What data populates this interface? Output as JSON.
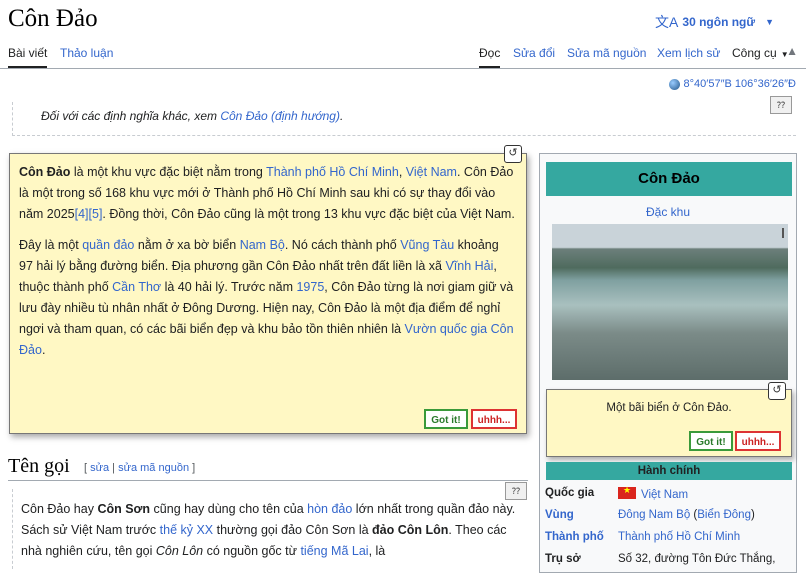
{
  "page": {
    "title": "Côn Đảo"
  },
  "language_button": {
    "label": "30 ngôn ngữ"
  },
  "tabs": {
    "article": "Bài viết",
    "talk": "Thảo luận",
    "read": "Đọc",
    "edit": "Sửa đổi",
    "edit_source": "Sửa mã nguồn",
    "history": "Xem lịch sử",
    "tools": "Công cụ"
  },
  "coordinates": "8°40′57″B 106°36′26″Đ",
  "hatnote": {
    "text": "Đối với các định nghĩa khác, xem ",
    "link": "Côn Đảo (định hướng)",
    "end": "."
  },
  "lead": {
    "p1_bold": "Côn Đảo",
    "p1_a": " là một khu vực đặc biệt nằm trong ",
    "p1_link1": "Thành phố Hồ Chí Minh",
    "p1_comma": ", ",
    "p1_link2": "Việt Nam",
    "p1_b": ". Côn Đảo là một trong số 168 khu vực mới ở Thành phố Hồ Chí Minh sau khi có sự thay đổi vào năm 2025",
    "ref4": "[4]",
    "ref5": "[5]",
    "p1_c": ". Đồng thời, Côn Đảo cũng là một trong 13 khu vực đặc biệt của Việt Nam.",
    "p2_a": "Đây là một ",
    "p2_link1": "quần đảo",
    "p2_b": " nằm ở xa bờ biển ",
    "p2_link2": "Nam Bộ",
    "p2_c": ". Nó cách thành phố ",
    "p2_link3": "Vũng Tàu",
    "p2_d": " khoảng 97 hải lý bằng đường biển. Địa phương gần Côn Đảo nhất trên đất liền là xã ",
    "p2_link4": "Vĩnh Hải",
    "p2_e": ", thuộc thành phố ",
    "p2_link5": "Cần Thơ",
    "p2_f": " là 40 hải lý. Trước năm ",
    "p2_link6": "1975",
    "p2_g": ", Côn Đảo từng là nơi giam giữ và lưu đày nhiều tù nhân nhất ở Đông Dương. Hiện nay, Côn Đảo là một địa điểm để nghỉ ngơi và tham quan, có các bãi biển đẹp và khu bảo tồn thiên nhiên là ",
    "p2_link7": "Vườn quốc gia Côn Đảo",
    "p2_h": "."
  },
  "buttons": {
    "got_it": "Got it!",
    "uhhh": "uhhh..."
  },
  "section": {
    "heading": "Tên gọi",
    "edit_open": "[ ",
    "edit": "sửa",
    "sep": " | ",
    "edit_source": "sửa mã nguồn",
    "edit_close": " ]",
    "t1": "Côn Đảo hay ",
    "b1": "Côn Sơn",
    "t2": " cũng hay dùng cho tên của ",
    "l1": "hòn đảo",
    "t3": " lớn nhất trong quần đảo này. Sách sử Việt Nam trước ",
    "l2": "thế kỷ XX",
    "t4": " thường gọi đảo Côn Sơn là ",
    "b2": "đảo Côn Lôn",
    "t5": ". Theo các nhà nghiên cứu, tên gọi ",
    "i1": "Côn Lôn",
    "t6": " có nguồn gốc từ ",
    "l3": "tiếng Mã Lai",
    "t7": ", là"
  },
  "infobox": {
    "title": "Côn Đảo",
    "subtitle": "Đặc khu",
    "caption": "Một bãi biển ở Côn Đảo.",
    "admin_header": "Hành chính",
    "rows": [
      {
        "key": "Quốc gia",
        "value": "Việt Nam"
      },
      {
        "key": "Vùng",
        "value": "Đông Nam Bộ",
        "value2": "Biển Đông"
      },
      {
        "key": "Thành phố",
        "value": "Thành phố Hồ Chí Minh"
      },
      {
        "key": "Trụ sở",
        "value": "Số 32, đường Tôn Đức Thắng,"
      }
    ]
  },
  "icons": [
    "translate-icon",
    "chevron-down-icon",
    "globe-icon",
    "undo-icon",
    "help-icon",
    "flag-icon"
  ],
  "colors": {
    "link": "#3366cc",
    "note_bg": "#fff8c4",
    "infobox_header": "#35a8a0"
  }
}
